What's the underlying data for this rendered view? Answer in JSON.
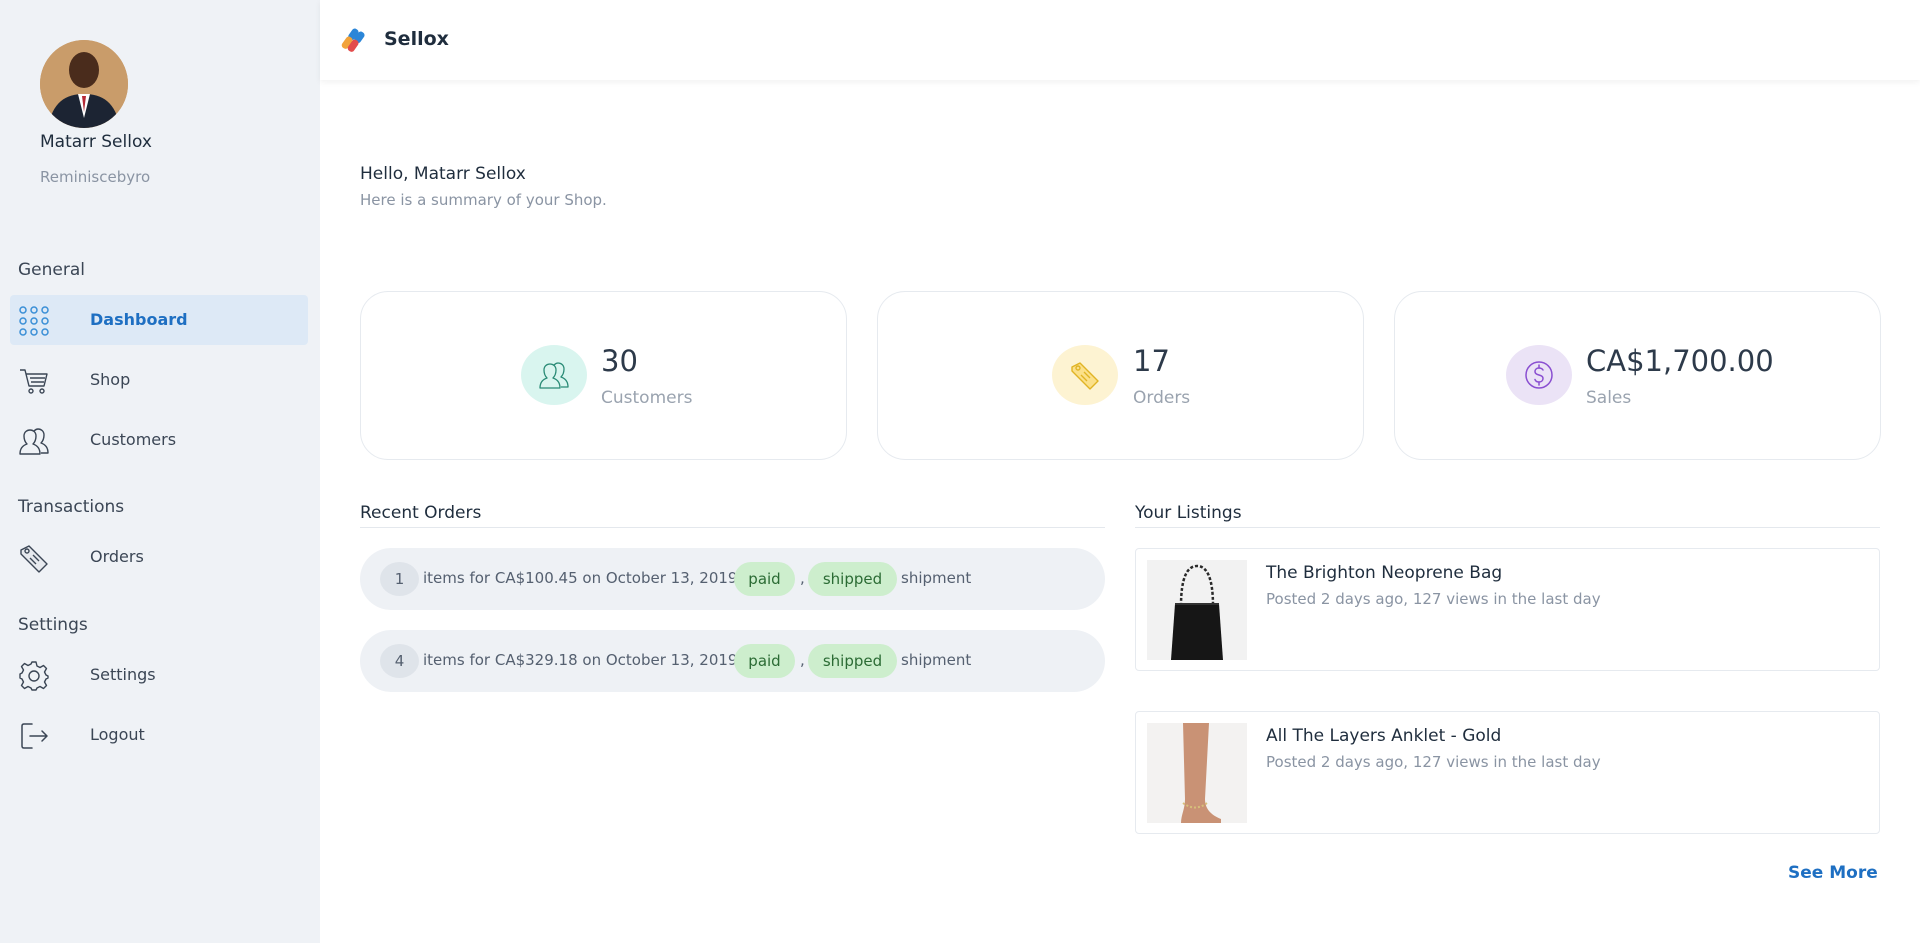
{
  "sidebar": {
    "profile": {
      "name": "Matarr Sellox",
      "handle": "Reminiscebyro"
    },
    "sections": [
      {
        "label": "General"
      },
      {
        "label": "Transactions"
      },
      {
        "label": "Settings"
      }
    ],
    "items": [
      {
        "label": "Dashboard",
        "icon": "grid-icon",
        "active": true
      },
      {
        "label": "Shop",
        "icon": "cart-icon"
      },
      {
        "label": "Customers",
        "icon": "users-icon"
      },
      {
        "label": "Orders",
        "icon": "tag-icon"
      },
      {
        "label": "Settings",
        "icon": "gear-icon"
      },
      {
        "label": "Logout",
        "icon": "logout-icon"
      }
    ]
  },
  "header": {
    "brand": "Sellox",
    "logo_icon": "sellox-logo-icon"
  },
  "greeting": {
    "title": "Hello, Matarr Sellox",
    "subtitle": "Here is a summary of your Shop."
  },
  "stats": [
    {
      "value": "30",
      "label": "Customers",
      "icon": "users-icon",
      "color": "#d9f5ef"
    },
    {
      "value": "17",
      "label": "Orders",
      "icon": "tag-icon",
      "color": "#fdf3d2"
    },
    {
      "value": "CA$1,700.00",
      "label": "Sales",
      "icon": "dollar-icon",
      "color": "#ebe3f6"
    }
  ],
  "recent_orders": {
    "title": "Recent Orders",
    "orders": [
      {
        "count": "1",
        "text": "items for CA$100.45 on October 13, 2019.",
        "payment": "paid",
        "separator": ",",
        "fulfillment": "shipped",
        "suffix": "shipment"
      },
      {
        "count": "4",
        "text": "items for CA$329.18 on October 13, 2019.",
        "payment": "paid",
        "separator": ",",
        "fulfillment": "shipped",
        "suffix": "shipment"
      }
    ]
  },
  "listings": {
    "title": "Your Listings",
    "items": [
      {
        "title": "The Brighton Neoprene Bag",
        "meta": "Posted 2 days ago, 127 views in the last day"
      },
      {
        "title": "All The Layers Anklet - Gold",
        "meta": "Posted 2 days ago, 127 views in the last day"
      }
    ],
    "see_more": "See More"
  },
  "colors": {
    "accent": "#1e6fc2",
    "sidebar_bg": "#eff2f6",
    "active_bg": "#dde9f6",
    "pill_bg": "#cdeecd",
    "pill_text": "#2b6b34"
  }
}
